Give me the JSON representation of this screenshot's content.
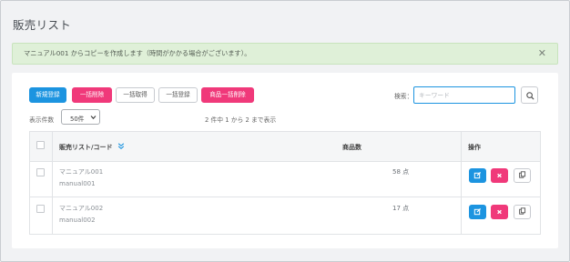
{
  "page": {
    "title": "販売リスト"
  },
  "alert": {
    "message": "マニュアル001 からコピーを作成します（時間がかかる場合がございます）。",
    "close_label": "✕"
  },
  "toolbar": {
    "new_label": "新規登録",
    "bulk_delete_label": "一括削除",
    "bulk_fetch_label": "一括取得",
    "bulk_register_label": "一括登録",
    "product_bulk_delete_label": "商品一括削除"
  },
  "search": {
    "label": "検索：",
    "placeholder": "キーワード",
    "value": ""
  },
  "pagination": {
    "per_page_label": "表示件数",
    "per_page_value": "50件",
    "count_text": "2 件中 1 から 2 まで表示"
  },
  "table": {
    "headers": {
      "name": "販売リスト/コード",
      "count": "商品数",
      "actions": "操作"
    },
    "rows": [
      {
        "name": "マニュアル001",
        "code": "manual001",
        "count": "58 点"
      },
      {
        "name": "マニュアル002",
        "code": "manual002",
        "count": "17 点"
      }
    ]
  },
  "colors": {
    "primary": "#1c94e0",
    "danger": "#f0397a",
    "alert_bg": "#dff0d8",
    "background": "#f1f2f4"
  },
  "icons": {
    "sort": "sort-chevron-icon",
    "search": "search-icon",
    "edit": "edit-icon",
    "delete": "delete-x-icon",
    "copy": "copy-icon",
    "close": "close-icon"
  }
}
